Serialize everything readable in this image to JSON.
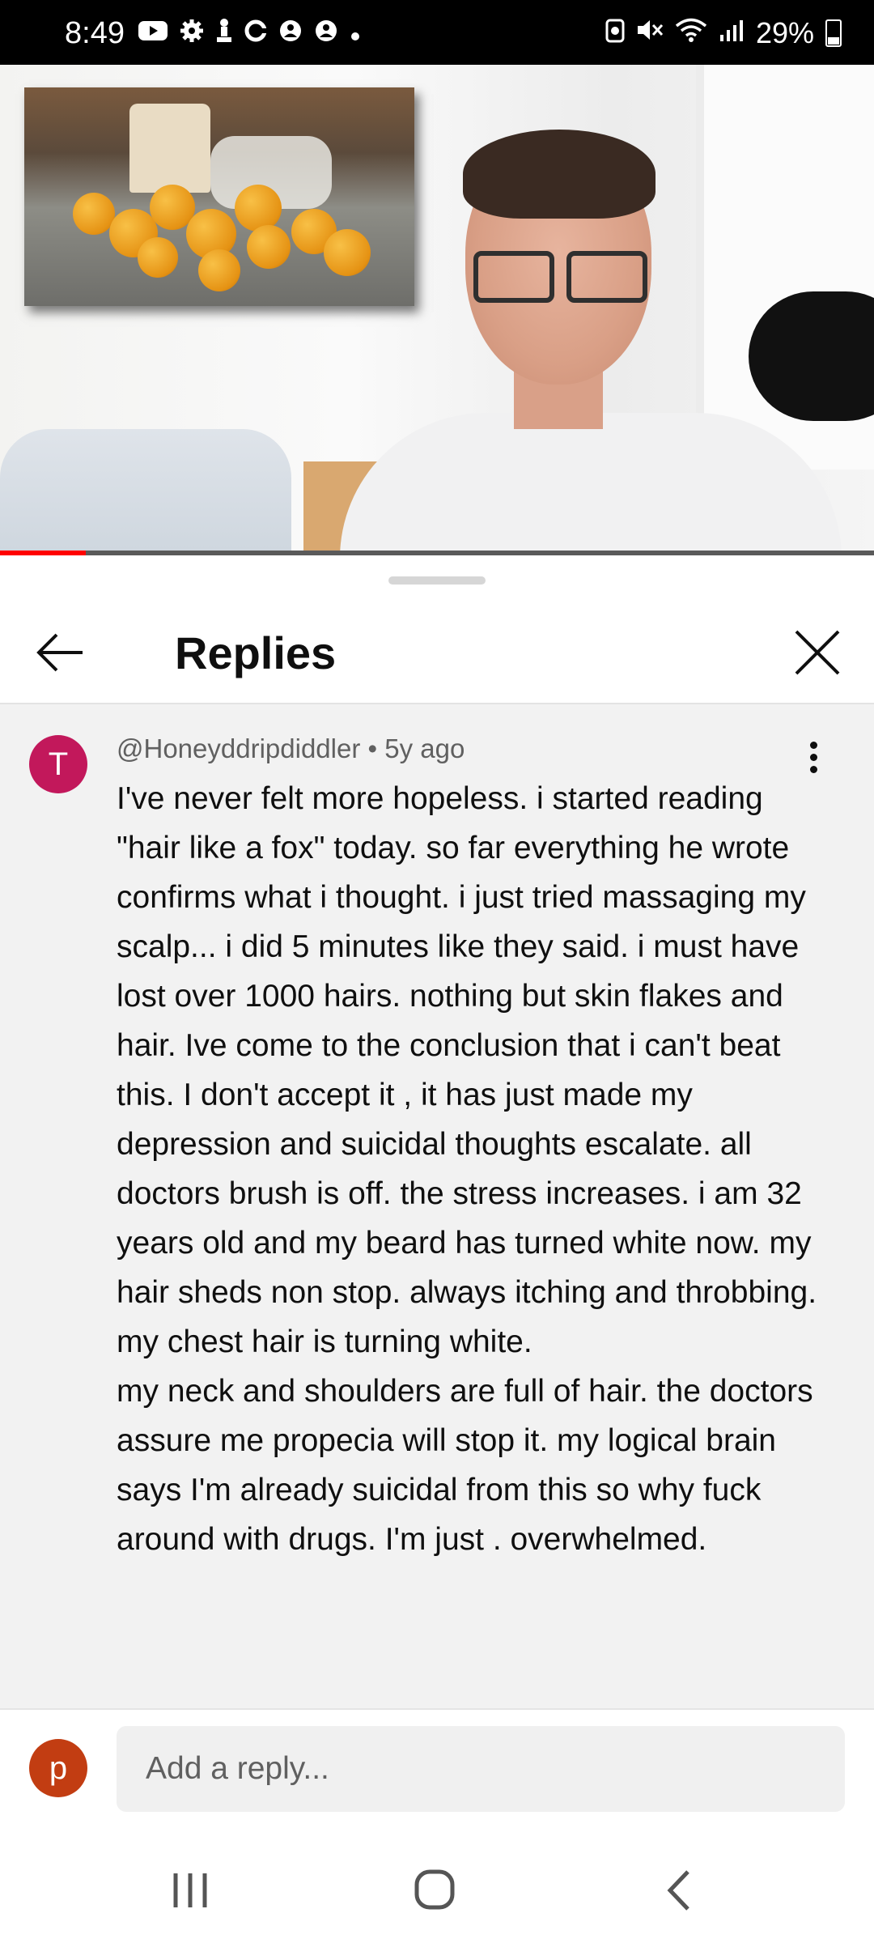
{
  "status_bar": {
    "time": "8:49",
    "battery": "29%",
    "icons_left": [
      "youtube-icon",
      "settings-icon",
      "chess-icon",
      "c-icon",
      "messenger-icon",
      "messenger-icon",
      "dot-icon"
    ],
    "icons_right": [
      "alarm-icon",
      "mute-icon",
      "wifi-icon",
      "signal-icon",
      "battery-icon"
    ]
  },
  "video": {
    "progress_fraction": 0.098,
    "accent": "#ff0000"
  },
  "replies_header": {
    "title": "Replies"
  },
  "comment": {
    "avatar_letter": "T",
    "avatar_color": "#c2185b",
    "author": "@Honeyddripdiddler",
    "separator": " • ",
    "age": "5y ago",
    "text": "I've never felt more hopeless. i started reading \"hair like a fox\" today. so far everything he wrote confirms what i thought. i just tried massaging my scalp... i did 5 minutes like they said. i must have lost over 1000 hairs. nothing but skin flakes and hair. Ive come to the conclusion that i can't beat this. I don't accept it , it has just made my depression and suicidal thoughts escalate. all doctors brush is off. the stress increases. i am 32 years old and my beard has turned white now. my hair sheds non stop. always itching and throbbing.  my chest hair is turning white.\nmy neck and shoulders are full of hair. the doctors assure me propecia will stop it. my logical brain says I'm already suicidal from this so why fuck around with drugs. I'm just . overwhelmed."
  },
  "reply_box": {
    "avatar_letter": "p",
    "avatar_color": "#c23d12",
    "placeholder": "Add a reply..."
  }
}
